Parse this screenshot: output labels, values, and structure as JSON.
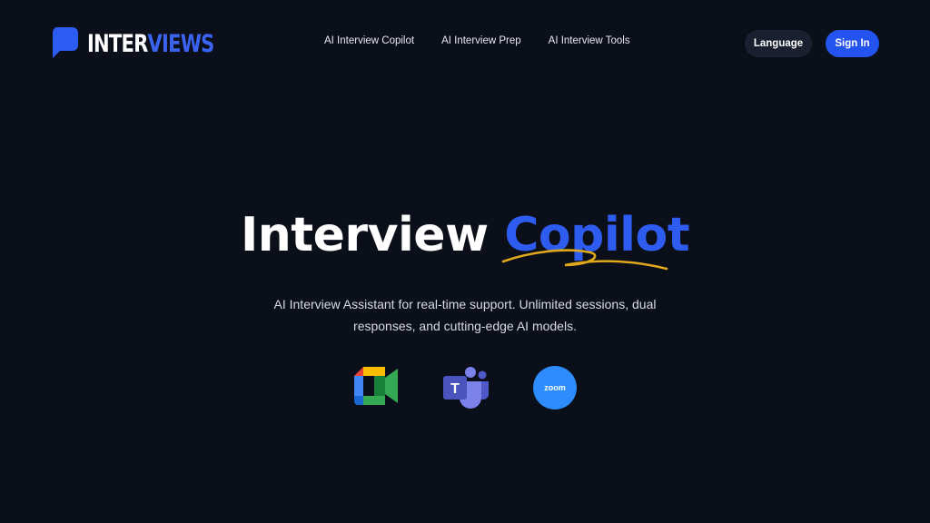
{
  "brand": {
    "logo_white": "INTER",
    "logo_blue": "VIEWS",
    "logo_icon": "speech-bubble-icon",
    "accent_color": "#2f5cf0"
  },
  "nav": {
    "items": [
      {
        "label": "AI Interview Copilot"
      },
      {
        "label": "AI Interview Prep"
      },
      {
        "label": "AI Interview Tools"
      }
    ]
  },
  "header_actions": {
    "language_label": "Language",
    "signin_label": "Sign In"
  },
  "hero": {
    "title_white": "Interview",
    "title_blue": "Copilot",
    "subtitle": "AI Interview Assistant for real-time support. Unlimited sessions, dual responses, and cutting-edge AI models."
  },
  "integrations": {
    "apps": [
      {
        "icon": "google-meet-icon"
      },
      {
        "icon": "microsoft-teams-icon"
      },
      {
        "icon": "zoom-icon",
        "label": "zoom"
      }
    ]
  }
}
